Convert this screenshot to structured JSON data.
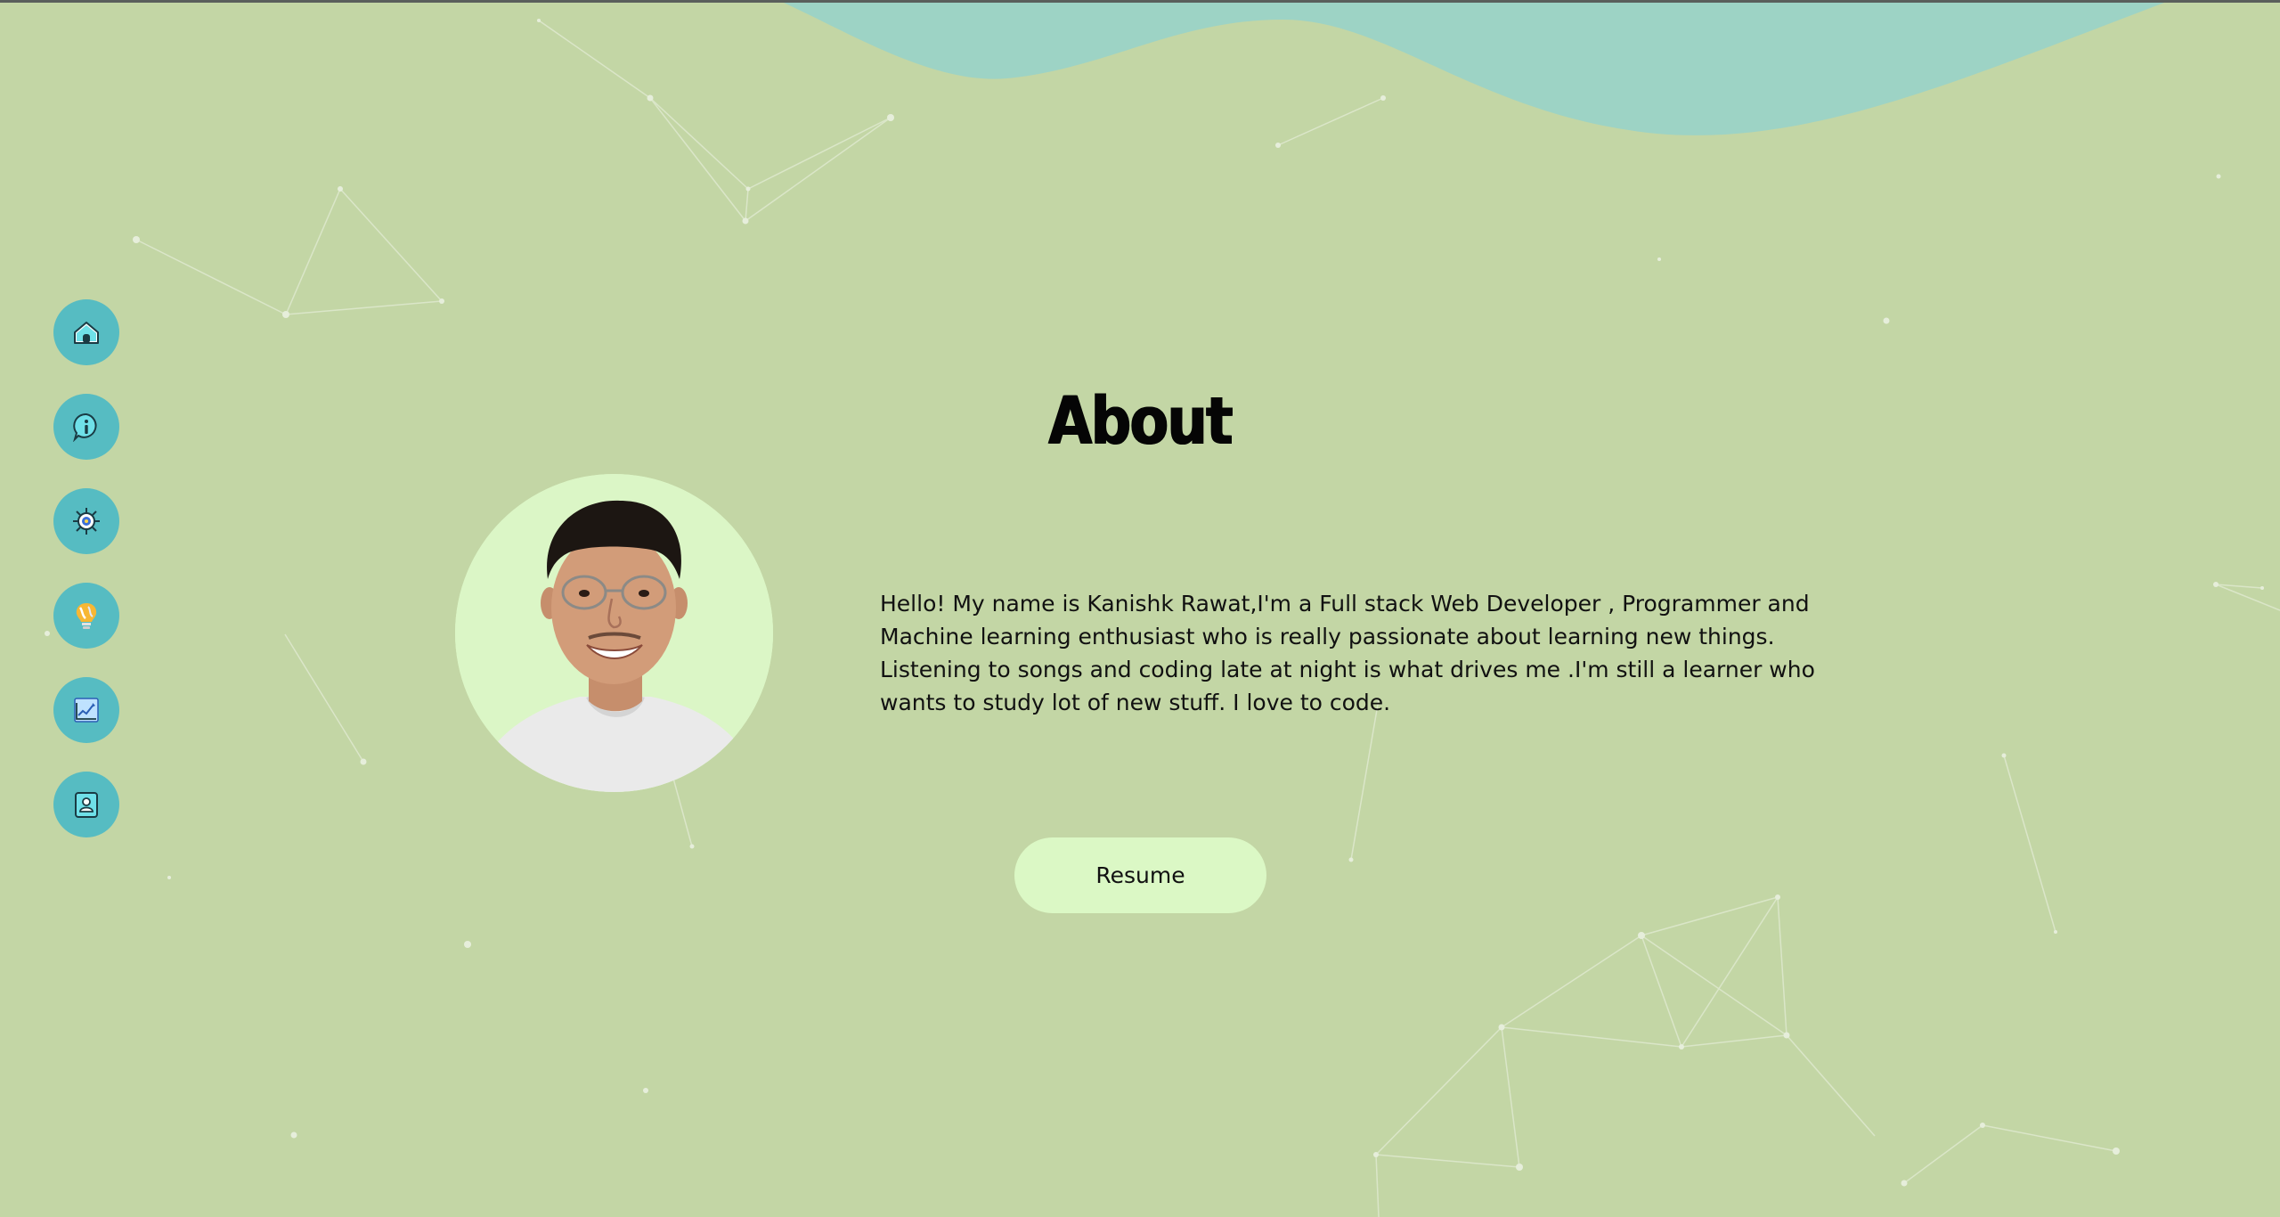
{
  "about": {
    "title": "About",
    "bio": "Hello! My name is Kanishk Rawat,I'm a Full stack Web Developer , Programmer and Machine learning enthusiast who is really passionate about learning new things. Listening to songs and coding late at night is what drives me .I'm still a learner who wants to study lot of new stuff. I love to code.",
    "resume_label": "Resume"
  },
  "nav": {
    "items": [
      {
        "name": "home",
        "icon": "home-icon"
      },
      {
        "name": "about",
        "icon": "info-icon"
      },
      {
        "name": "skills",
        "icon": "gear-brain-icon"
      },
      {
        "name": "ideas",
        "icon": "lightbulb-icon"
      },
      {
        "name": "projects",
        "icon": "chart-icon"
      },
      {
        "name": "contact",
        "icon": "contact-card-icon"
      }
    ]
  },
  "colors": {
    "background": "#c3d6a5",
    "wave": "#9dd3c5",
    "nav_button": "#56bcc2",
    "photo_bg": "#dbf6c6",
    "resume_button": "#dbf8c5"
  }
}
